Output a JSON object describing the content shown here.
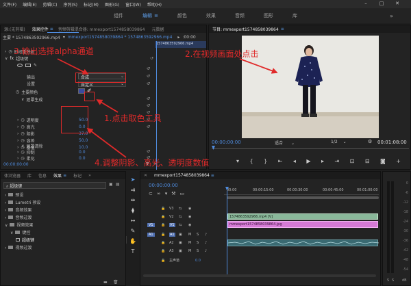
{
  "menu": [
    "文件(F)",
    "编辑(E)",
    "剪辑(C)",
    "序列(S)",
    "标记(M)",
    "图形(G)",
    "窗口(W)",
    "帮助(H)"
  ],
  "window_controls": [
    "–",
    "□",
    "✕"
  ],
  "workspaces": [
    "组件",
    "编辑",
    "颜色",
    "效果",
    "音频",
    "图形",
    "库"
  ],
  "active_workspace": "编辑",
  "effect_tabs": [
    "源:(无剪辑)",
    "效果控件",
    "音频剪辑混合器: mmexport1574858039864",
    "元数据"
  ],
  "effect_tab_menu": "≡",
  "effect_header": {
    "master": "主要 * 1574863592966.mp4",
    "clip": "mmexport1574858039864 * 1574863592966.mp4",
    "timecode": ":00:00",
    "clip_label": "1574863592966.mp4"
  },
  "effect_rows": {
    "remap": "时间重映射",
    "fx": "超级键",
    "output_label": "输出",
    "output_value": "合成",
    "settings_label": "设置",
    "settings_value": "自定义",
    "key_color_label": "主要颜色",
    "matte_gen": "遮罩生成",
    "transparency_label": "透明度",
    "transparency_value": "50.0",
    "highlight_label": "高光",
    "highlight_value": "0.0",
    "shadow_label": "阴影",
    "shadow_value": "37.0",
    "tolerance_label": "容差",
    "tolerance_value": "50.0",
    "pedestal_label": "基值",
    "pedestal_value": "10.0",
    "matte_cleanup": "遮罩清除",
    "choke_label": "抑制",
    "choke_value": "0.0",
    "soften_label": "柔化",
    "soften_value": "0.0"
  },
  "effect_time": "00:00:00:00",
  "program": {
    "title": "节目: mmexport1574858039864",
    "menu_icon": "≡",
    "timecode": "00:00:00:00",
    "fit": "适合",
    "ratio": "1/2",
    "duration": "00:01:08:00"
  },
  "project_tabs": [
    "体浏览器",
    "库",
    "信息",
    "效果",
    "标记"
  ],
  "project_tab_menu": "≡",
  "effects_search": "超级键",
  "effects_tree": [
    {
      "label": "预设",
      "indent": 0
    },
    {
      "label": "Lumetri 预设",
      "indent": 0
    },
    {
      "label": "音频效果",
      "indent": 0
    },
    {
      "label": "音频过渡",
      "indent": 0
    },
    {
      "label": "视频效果",
      "indent": 0
    },
    {
      "label": "键控",
      "indent": 1
    },
    {
      "label": "超级键",
      "indent": 2
    },
    {
      "label": "视频过渡",
      "indent": 0
    }
  ],
  "timeline": {
    "tab": "mmexport1574858039864",
    "menu_icon": "≡",
    "timecode": "00:00:00:00",
    "ruler": [
      "00:00",
      "00:00:15:00",
      "00:00:30:00",
      "00:00:45:00",
      "00:01:00:00"
    ],
    "tracks": [
      "V3",
      "V2",
      "V1",
      "A1",
      "A2",
      "A3",
      "主声道"
    ],
    "source_v": "V1",
    "source_a": "A1",
    "master_value": "0.0",
    "clip_v2": "1574863592966.mp4 [V]",
    "clip_v1": "mmexport1574858039864.jpg"
  },
  "meter_ticks": [
    "0",
    "-6",
    "-12",
    "-18",
    "-24",
    "-30",
    "-36",
    "-42",
    "-48",
    "-54"
  ],
  "meter_db": "dB",
  "annotations": {
    "a1": "1.点击取色工具",
    "a2": "2.在视频画面处点击",
    "a3": "3.输出选择alpha通道",
    "a4": "4.调整阴影、高光、透明度数值"
  },
  "colors": {
    "accent": "#4f8bdd",
    "annotation": "#e02a2a",
    "clip_green": "#8ab89a",
    "clip_pink": "#d57ad5",
    "audio_clip": "#3a6a72"
  }
}
